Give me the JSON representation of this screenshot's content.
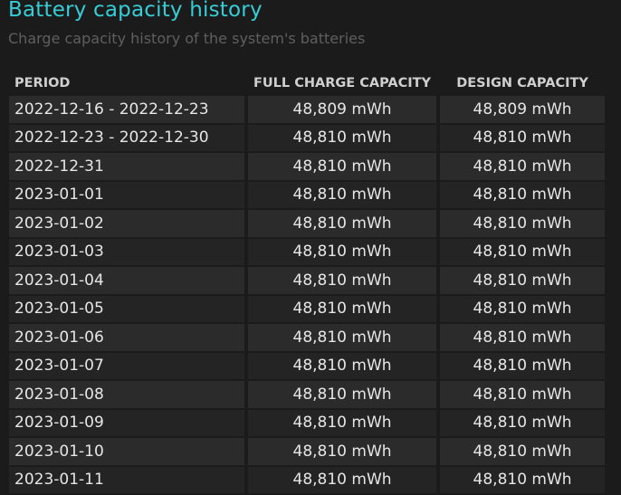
{
  "title": "Battery capacity history",
  "subtitle": "Charge capacity history of the system's batteries",
  "headers": {
    "period": "PERIOD",
    "full": "FULL CHARGE CAPACITY",
    "design": "DESIGN CAPACITY"
  },
  "rows": [
    {
      "period": "2022-12-16 - 2022-12-23",
      "full": "48,809 mWh",
      "design": "48,809 mWh"
    },
    {
      "period": "2022-12-23 - 2022-12-30",
      "full": "48,810 mWh",
      "design": "48,810 mWh"
    },
    {
      "period": "2022-12-31",
      "full": "48,810 mWh",
      "design": "48,810 mWh"
    },
    {
      "period": "2023-01-01",
      "full": "48,810 mWh",
      "design": "48,810 mWh"
    },
    {
      "period": "2023-01-02",
      "full": "48,810 mWh",
      "design": "48,810 mWh"
    },
    {
      "period": "2023-01-03",
      "full": "48,810 mWh",
      "design": "48,810 mWh"
    },
    {
      "period": "2023-01-04",
      "full": "48,810 mWh",
      "design": "48,810 mWh"
    },
    {
      "period": "2023-01-05",
      "full": "48,810 mWh",
      "design": "48,810 mWh"
    },
    {
      "period": "2023-01-06",
      "full": "48,810 mWh",
      "design": "48,810 mWh"
    },
    {
      "period": "2023-01-07",
      "full": "48,810 mWh",
      "design": "48,810 mWh"
    },
    {
      "period": "2023-01-08",
      "full": "48,810 mWh",
      "design": "48,810 mWh"
    },
    {
      "period": "2023-01-09",
      "full": "48,810 mWh",
      "design": "48,810 mWh"
    },
    {
      "period": "2023-01-10",
      "full": "48,810 mWh",
      "design": "48,810 mWh"
    },
    {
      "period": "2023-01-11",
      "full": "48,810 mWh",
      "design": "48,810 mWh"
    }
  ]
}
